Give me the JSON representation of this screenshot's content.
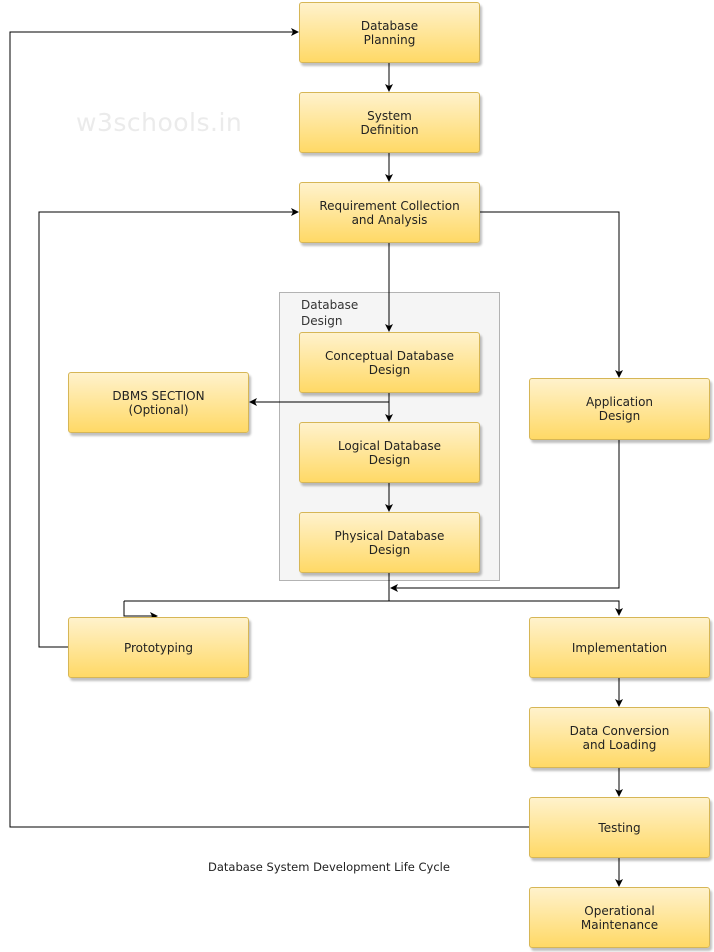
{
  "watermark": "w3schools.in",
  "caption": "Database System Development Life Cycle",
  "group": {
    "label": "Database\nDesign"
  },
  "boxes": {
    "planning": "Database\nPlanning",
    "system_definition": "System\nDefinition",
    "requirements": "Requirement Collection\nand Analysis",
    "conceptual": "Conceptual Database\nDesign",
    "logical": "Logical Database\nDesign",
    "physical": "Physical Database\nDesign",
    "dbms": "DBMS SECTION\n(Optional)",
    "application": "Application\nDesign",
    "prototyping": "Prototyping",
    "implementation": "Implementation",
    "conversion": "Data Conversion\nand Loading",
    "testing": "Testing",
    "maintenance": "Operational\nMaintenance"
  },
  "colors": {
    "box_fill_top": "#fff2cc",
    "box_fill_bottom": "#ffd966",
    "box_border": "#d6b656",
    "group_fill": "#f5f5f5"
  }
}
